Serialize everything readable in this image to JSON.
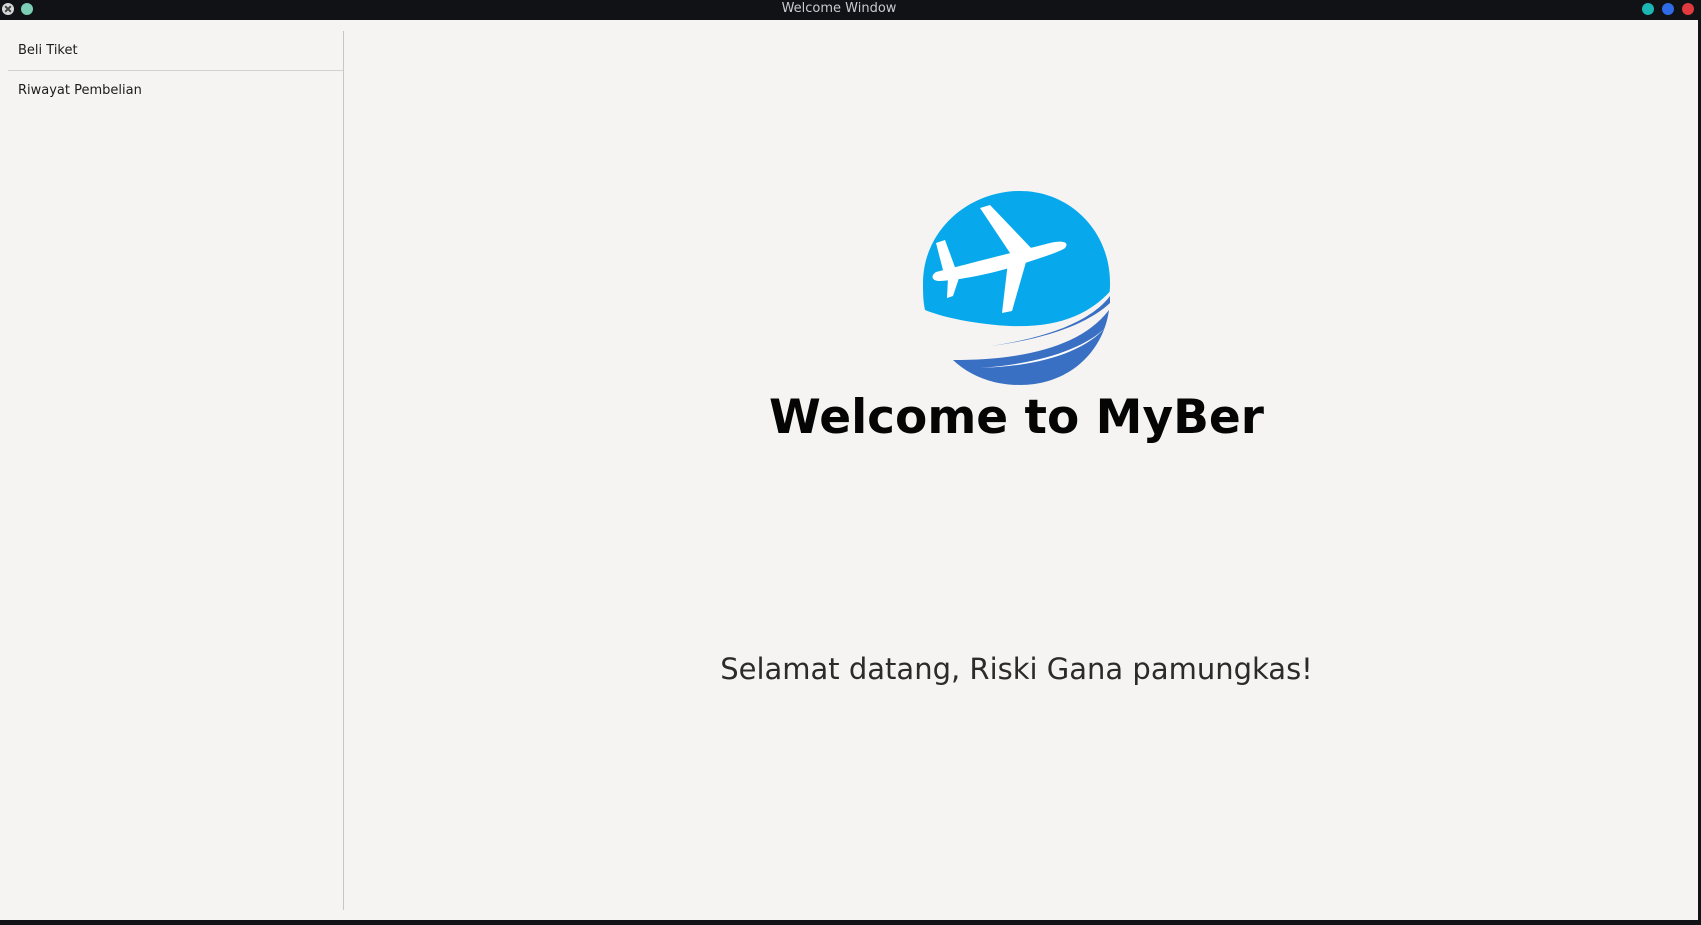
{
  "window": {
    "title": "Welcome Window"
  },
  "sidebar": {
    "items": [
      {
        "label": "Beli Tiket"
      },
      {
        "label": "Riwayat Pembelian"
      }
    ]
  },
  "main": {
    "logo_icon": "airplane-globe-logo-icon",
    "title": "Welcome to MyBer",
    "greeting": "Selamat datang, Riski Gana pamungkas!"
  },
  "colors": {
    "logo_primary": "#07a9ec",
    "logo_secondary": "#3a70c4",
    "window_bg": "#f5f4f2",
    "titlebar_bg": "#101216"
  }
}
